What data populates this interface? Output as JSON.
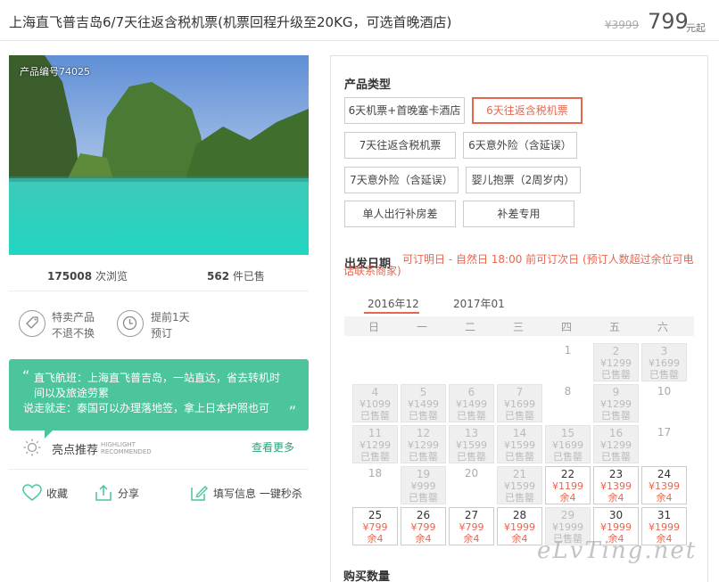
{
  "header": {
    "title": "上海直飞普吉岛6/7天往返含税机票(机票回程升级至20KG，可选首晚酒店)",
    "old_price": "¥3999",
    "price": "799",
    "price_unit": "元起"
  },
  "product": {
    "code": "产品编号74025",
    "views_num": "175008",
    "views_label": "次浏览",
    "sold_num": "562",
    "sold_label": "件已售"
  },
  "features": [
    {
      "icon": "tag-icon",
      "line1": "特卖产品",
      "line2": "不退不换"
    },
    {
      "icon": "clock-icon",
      "line1": "提前1天",
      "line2": "预订"
    }
  ],
  "highlight": {
    "line1": "直飞航班：上海直飞普吉岛，一站直达，省去转机时",
    "line2": "间以及旅途劳累",
    "line3": "说走就走：泰国可以办理落地签，拿上日本护照也可",
    "label": "亮点推荐",
    "en1": "HIGHLIGHT",
    "en2": "RECOMMENDED",
    "see_more": "查看更多"
  },
  "actions": {
    "favorite": "收藏",
    "share": "分享",
    "fill_info": "填写信息 一键秒杀"
  },
  "panel": {
    "type_title": "产品类型",
    "options": [
      "6天机票+首晚塞卡酒店",
      "6天往返含税机票",
      "7天往返含税机票",
      "6天意外险（含延误）",
      "7天意外险（含延误）",
      "婴儿抱票（2周岁内）",
      "单人出行补房差",
      "补差专用"
    ],
    "selected_option": "6天往返含税机票",
    "date_title": "出发日期",
    "date_note": "可订明日 - 自然日 18:00 前可订次日   (预订人数超过余位可电话联系商家)",
    "months": [
      "2016年12",
      "2017年01"
    ],
    "weekdays": [
      "日",
      "一",
      "二",
      "三",
      "四",
      "五",
      "六"
    ],
    "buy_title": "购买数量"
  },
  "calendar": [
    {
      "day": "1",
      "state": "plain"
    },
    {
      "day": "2",
      "price": "¥1299",
      "note": "已售罄",
      "state": "dis"
    },
    {
      "day": "3",
      "price": "¥1699",
      "note": "已售罄",
      "state": "dis"
    },
    {
      "day": "4",
      "price": "¥1099",
      "note": "已售罄",
      "state": "dis"
    },
    {
      "day": "5",
      "price": "¥1499",
      "note": "已售罄",
      "state": "dis"
    },
    {
      "day": "6",
      "price": "¥1499",
      "note": "已售罄",
      "state": "dis"
    },
    {
      "day": "7",
      "price": "¥1699",
      "note": "已售罄",
      "state": "dis"
    },
    {
      "day": "8",
      "state": "plain"
    },
    {
      "day": "9",
      "price": "¥1299",
      "note": "已售罄",
      "state": "dis"
    },
    {
      "day": "10",
      "state": "plain"
    },
    {
      "day": "11",
      "price": "¥1299",
      "note": "已售罄",
      "state": "dis"
    },
    {
      "day": "12",
      "price": "¥1299",
      "note": "已售罄",
      "state": "dis"
    },
    {
      "day": "13",
      "price": "¥1599",
      "note": "已售罄",
      "state": "dis"
    },
    {
      "day": "14",
      "price": "¥1599",
      "note": "已售罄",
      "state": "dis"
    },
    {
      "day": "15",
      "price": "¥1699",
      "note": "已售罄",
      "state": "dis"
    },
    {
      "day": "16",
      "price": "¥1299",
      "note": "已售罄",
      "state": "dis"
    },
    {
      "day": "17",
      "state": "plain"
    },
    {
      "day": "18",
      "state": "plain"
    },
    {
      "day": "19",
      "price": "¥999",
      "note": "已售罄",
      "state": "dis"
    },
    {
      "day": "20",
      "state": "plain"
    },
    {
      "day": "21",
      "price": "¥1599",
      "note": "已售罄",
      "state": "dis"
    },
    {
      "day": "22",
      "price": "¥1199",
      "note": "余4",
      "state": "av"
    },
    {
      "day": "23",
      "price": "¥1399",
      "note": "余4",
      "state": "av"
    },
    {
      "day": "24",
      "price": "¥1399",
      "note": "余4",
      "state": "av"
    },
    {
      "day": "25",
      "price": "¥799",
      "note": "余4",
      "state": "av"
    },
    {
      "day": "26",
      "price": "¥799",
      "note": "余4",
      "state": "av"
    },
    {
      "day": "27",
      "price": "¥799",
      "note": "余4",
      "state": "av"
    },
    {
      "day": "28",
      "price": "¥1999",
      "note": "余4",
      "state": "av"
    },
    {
      "day": "29",
      "price": "¥1999",
      "note": "已售罄",
      "state": "dis"
    },
    {
      "day": "30",
      "price": "¥1999",
      "note": "余4",
      "state": "av"
    },
    {
      "day": "31",
      "price": "¥1999",
      "note": "余4",
      "state": "av"
    }
  ],
  "watermark": "eLvTing.net"
}
